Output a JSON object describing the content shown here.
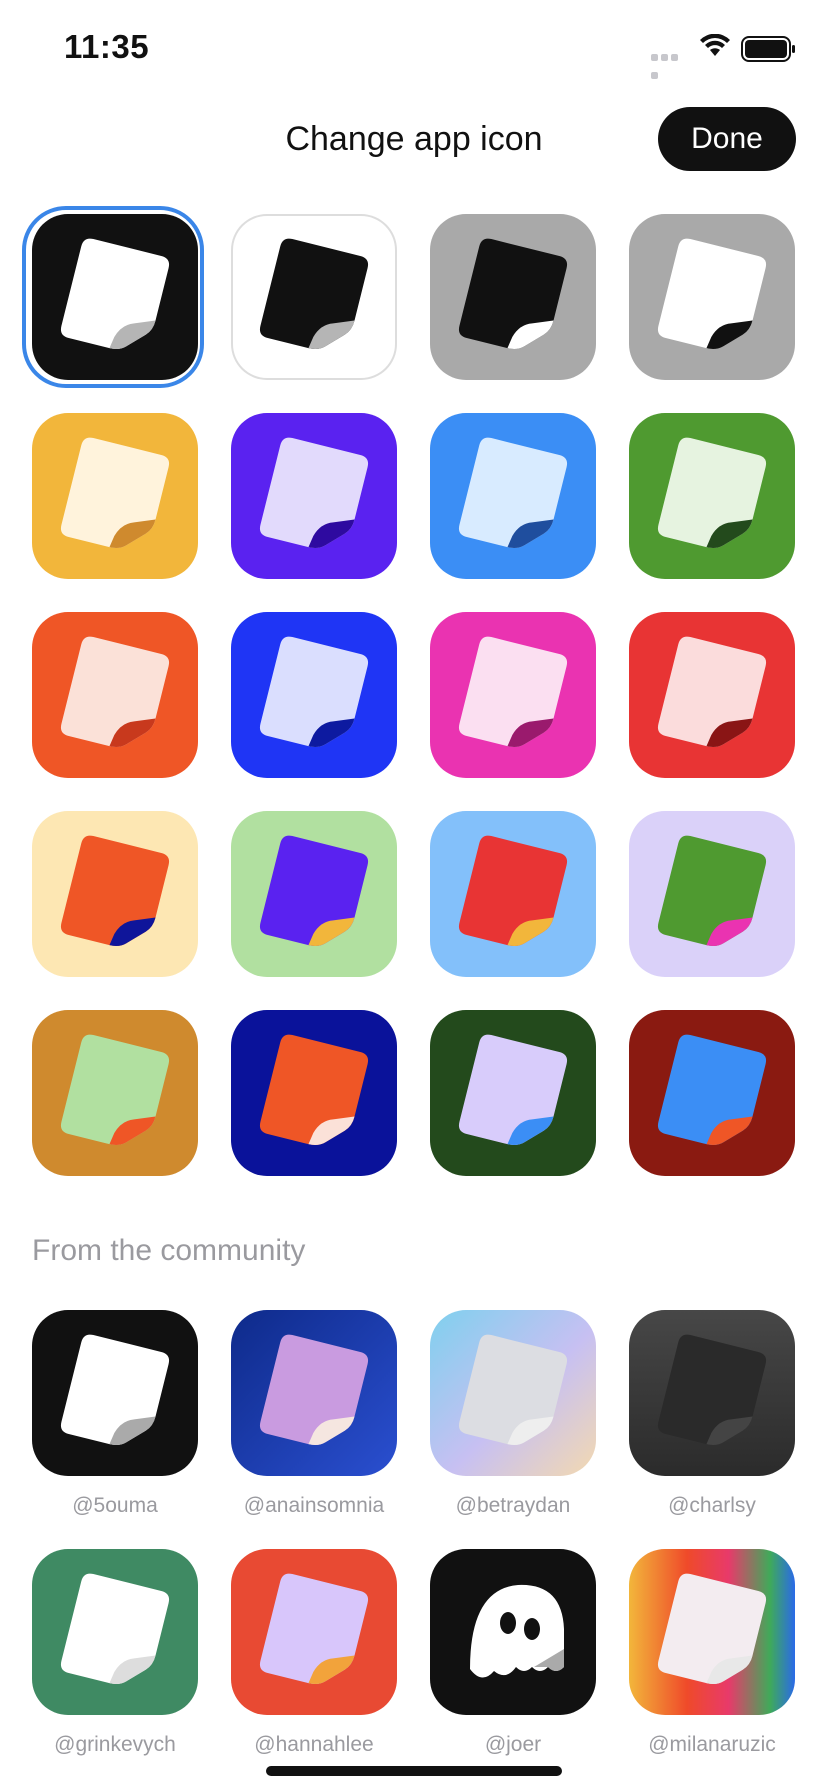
{
  "status_bar": {
    "time": "11:35"
  },
  "header": {
    "title": "Change app icon",
    "done_label": "Done"
  },
  "icons": [
    {
      "id": "black",
      "bg": "#111111",
      "paper": "#ffffff",
      "fold": "#b5b5b5",
      "selected": true
    },
    {
      "id": "white",
      "bg": "#ffffff",
      "paper": "#111111",
      "fold": "#b5b5b5",
      "border": "#dddddd"
    },
    {
      "id": "gray-black",
      "bg": "#a9a9a9",
      "paper": "#111111",
      "fold": "#ffffff"
    },
    {
      "id": "gray-white",
      "bg": "#a9a9a9",
      "paper": "#ffffff",
      "fold": "#111111"
    },
    {
      "id": "yellow",
      "bg": "#f2b63b",
      "paper": "#fff3dc",
      "fold": "#cf8a2e"
    },
    {
      "id": "violet",
      "bg": "#5a22f0",
      "paper": "#e2dafc",
      "fold": "#2e0aa0"
    },
    {
      "id": "blue",
      "bg": "#3b8ef5",
      "paper": "#d8ebff",
      "fold": "#1f4e9e"
    },
    {
      "id": "green",
      "bg": "#4f9a30",
      "paper": "#e6f3e0",
      "fold": "#234a1c"
    },
    {
      "id": "orange",
      "bg": "#ef5626",
      "paper": "#fbe1d8",
      "fold": "#c8391d"
    },
    {
      "id": "royal-blue",
      "bg": "#1f35f5",
      "paper": "#dadefe",
      "fold": "#0d1aa0"
    },
    {
      "id": "pink",
      "bg": "#ea33b1",
      "paper": "#fbdff1",
      "fold": "#9a1a6d"
    },
    {
      "id": "red",
      "bg": "#e83434",
      "paper": "#fbdcdc",
      "fold": "#8a1515"
    },
    {
      "id": "cream-orange",
      "bg": "#fde7b3",
      "paper": "#ef5626",
      "fold": "#0f159a"
    },
    {
      "id": "mint-violet",
      "bg": "#b1e0a0",
      "paper": "#5a22f0",
      "fold": "#f2b63b"
    },
    {
      "id": "sky-red",
      "bg": "#83c0fa",
      "paper": "#e83434",
      "fold": "#f2b63b"
    },
    {
      "id": "lilac-green",
      "bg": "#dad1f9",
      "paper": "#4f9a30",
      "fold": "#ea33b1"
    },
    {
      "id": "ochre-mint",
      "bg": "#cf8a2e",
      "paper": "#b1e0a0",
      "fold": "#ef5626"
    },
    {
      "id": "navy-orange",
      "bg": "#0a129a",
      "paper": "#ef5626",
      "fold": "#fbe1d8"
    },
    {
      "id": "forest-lilac",
      "bg": "#234a1c",
      "paper": "#d8ccfb",
      "fold": "#3b8ef5"
    },
    {
      "id": "maroon-blue",
      "bg": "#8a1a11",
      "paper": "#3b8ef5",
      "fold": "#ef5626"
    }
  ],
  "community": {
    "title": "From the community",
    "items": [
      {
        "handle": "@5ouma",
        "bg": "#111111",
        "paper": "#ffffff",
        "fold": "#aaaaaa"
      },
      {
        "handle": "@anainsomnia",
        "bg": "#1a35b0",
        "paper": "#c99be0",
        "fold": "#f5e6e0"
      },
      {
        "handle": "@betraydan",
        "bg": "#c9c5ef",
        "paper": "#dcdde2",
        "fold": "#eeeeee"
      },
      {
        "handle": "@charlsy",
        "bg": "#3a3a3a",
        "paper": "#2a2a2a",
        "fold": "#444444"
      },
      {
        "handle": "@grinkevych",
        "bg": "#3f8a63",
        "paper": "#ffffff",
        "fold": "#dddddd"
      },
      {
        "handle": "@hannahlee",
        "bg": "#e84a33",
        "paper": "#d8c6fb",
        "fold": "#f2a33b"
      },
      {
        "handle": "@joer",
        "bg": "#111111",
        "paper": "#ffffff",
        "fold": "#aaaaaa"
      },
      {
        "handle": "@milanaruzic",
        "bg": "#f05a2a",
        "paper": "#f3ecf0",
        "fold": "#e8e8e8"
      }
    ]
  }
}
